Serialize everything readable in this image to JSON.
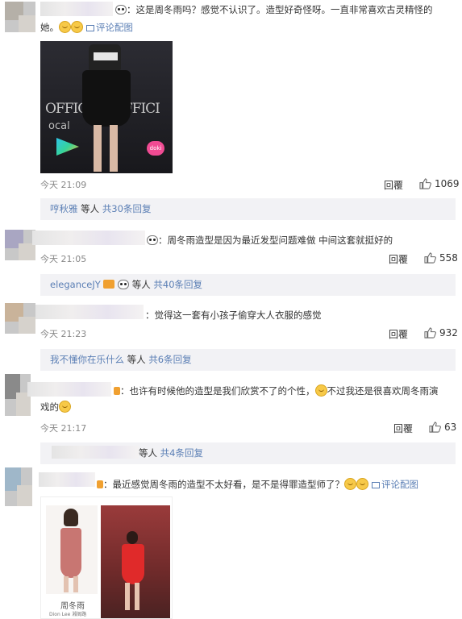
{
  "comments": [
    {
      "text_line1": "：这是周冬雨吗？感觉不认识了。造型好奇怪呀。一直非常喜欢古灵精怪的",
      "text_line2_prefix": "她。",
      "view_image": "评论配图",
      "time": "今天 21:09",
      "reply": "回覆",
      "likes": "1069",
      "sub": {
        "name": "哼秋雅",
        "mid": " 等人 ",
        "count": "共30条回复"
      }
    },
    {
      "text": "：周冬雨造型是因为最近发型问题难做 中间这套就挺好的",
      "time": "今天 21:05",
      "reply": "回覆",
      "likes": "558",
      "sub": {
        "name": "eleganceJY",
        "mid": " 等人 ",
        "count": "共40条回复"
      }
    },
    {
      "text": "：觉得这一套有小孩子偷穿大人衣服的感觉",
      "time": "今天 21:23",
      "reply": "回覆",
      "likes": "932",
      "sub": {
        "name": "我不懂你在乐什么",
        "mid": " 等人 ",
        "count": "共6条回复"
      }
    },
    {
      "text_line1_a": "：也许有时候他的造型是我们欣赏不了的个性，",
      "text_line1_b": "不过我还是很喜欢周冬雨演",
      "text_line2_prefix": "戏的",
      "time": "今天 21:17",
      "reply": "回覆",
      "likes": "63",
      "sub": {
        "name": "",
        "mid": "等人 ",
        "count": "共4条回复"
      }
    },
    {
      "text": "：最近感觉周冬雨的造型不太好看，是不是得罪造型师了？",
      "view_image": "评论配图",
      "caption": "周冬雨",
      "caption_small": "Dion Lee  湘阁路"
    }
  ]
}
